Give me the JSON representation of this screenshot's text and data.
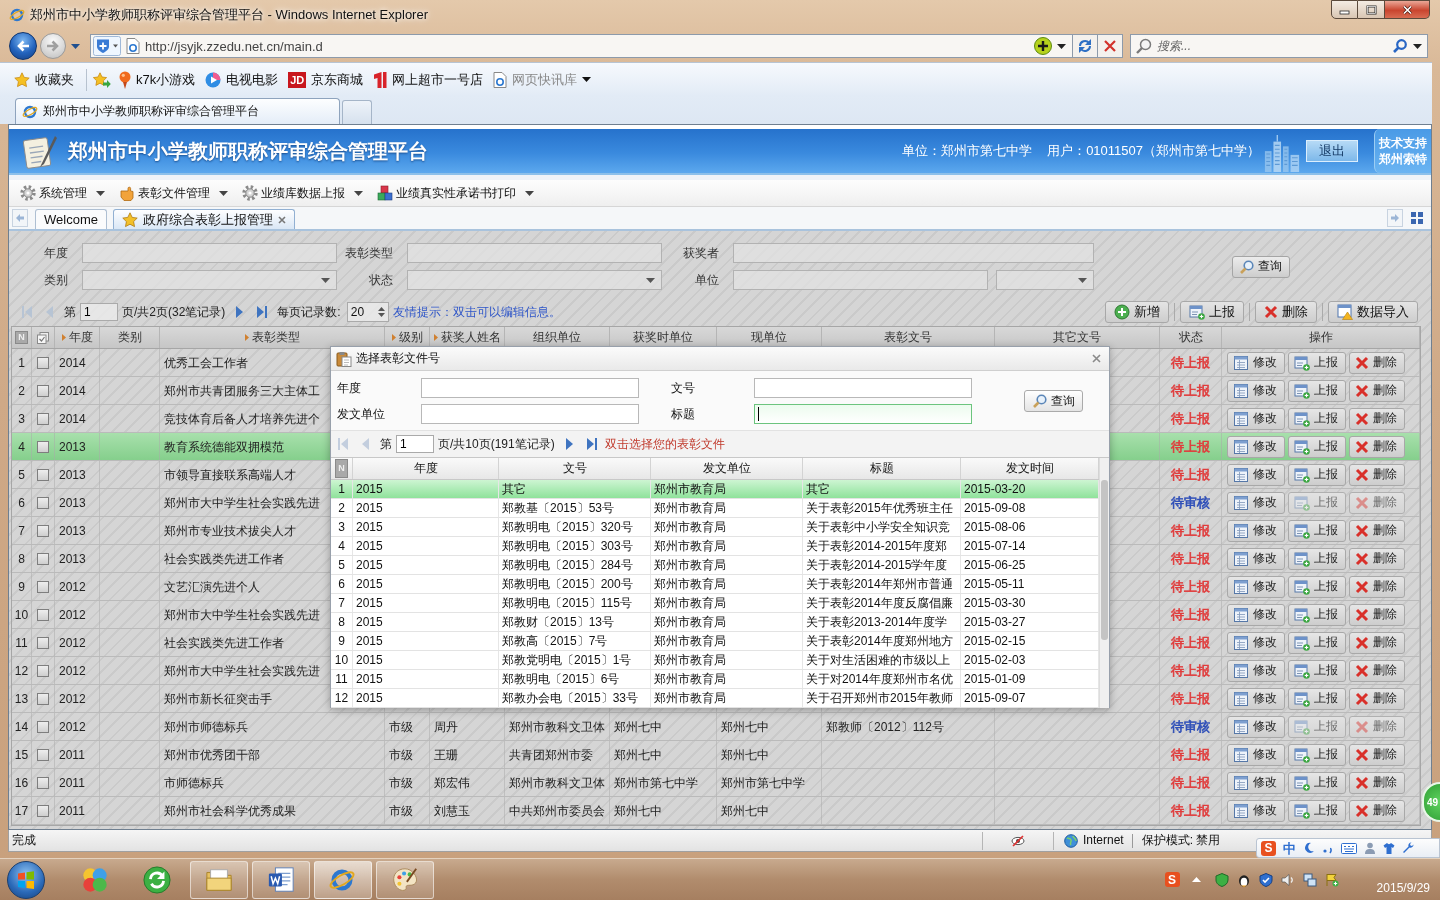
{
  "window": {
    "title": "郑州市中小学教师职称评审综合管理平台 - Windows Internet Explorer"
  },
  "address_bar": {
    "back_disabled": false,
    "forward_disabled": true,
    "url": "http://jsyjk.zzedu.net.cn/main.d"
  },
  "search_box": {
    "placeholder": "搜索..."
  },
  "favorites_bar": {
    "label": "收藏夹",
    "links": [
      {
        "kind": "pin",
        "label": "k7k小游戏",
        "disabled": false,
        "dropdown": false
      },
      {
        "kind": "play",
        "label": "电视电影",
        "disabled": false,
        "dropdown": false
      },
      {
        "kind": "badge",
        "badge": "JD",
        "label": "京东商城",
        "disabled": false,
        "dropdown": false
      },
      {
        "kind": "bars",
        "label": "网上超市一号店",
        "disabled": false,
        "dropdown": false
      },
      {
        "kind": "page",
        "label": "网页快讯库",
        "disabled": true,
        "dropdown": true
      }
    ]
  },
  "browser_tabs": [
    {
      "label": "郑州市中小学教师职称评审综合管理平台",
      "selected": true
    }
  ],
  "site_header": {
    "title": "郑州市中小学教师职称评审综合管理平台",
    "unit": "单位：郑州市第七中学",
    "user": "用户：01011507（郑州市第七中学）",
    "logout": "退出",
    "support": [
      "技术支持",
      "郑州索特"
    ]
  },
  "menu": [
    {
      "kind": "gear",
      "label": "系统管理"
    },
    {
      "kind": "hand",
      "label": "表彰文件管理"
    },
    {
      "kind": "gear",
      "label": "业绩库数据上报"
    },
    {
      "kind": "cubes",
      "label": "业绩真实性承诺书打印"
    }
  ],
  "page_tabs": [
    {
      "kind": "plain",
      "label": "Welcome",
      "selected": false,
      "closable": false
    },
    {
      "kind": "star",
      "label": "政府综合表彰上报管理",
      "selected": true,
      "closable": true
    }
  ],
  "filters": {
    "fields": [
      {
        "kind": "text",
        "label": "年度"
      },
      {
        "kind": "text",
        "label": "表彰类型"
      },
      {
        "kind": "text",
        "label": "获奖者"
      },
      {
        "kind": "select",
        "label": "类别"
      },
      {
        "kind": "select",
        "label": "状态"
      },
      {
        "kind": "text-select",
        "label": "单位"
      }
    ],
    "search_button": "查询"
  },
  "pager": {
    "nav": [
      {
        "kind": "first",
        "disabled": true
      },
      {
        "kind": "prev",
        "disabled": true
      },
      {
        "kind": "next",
        "disabled": false
      },
      {
        "kind": "last",
        "disabled": false
      }
    ],
    "page_label": "第",
    "page": "1",
    "page_info": "页/共2页(32笔记录)",
    "page_size_label": "每页记录数:",
    "page_size": "20",
    "hint": "友情提示：双击可以编辑信息。"
  },
  "toolbar": [
    {
      "kind": "add",
      "label": "新增"
    },
    {
      "kind": "report",
      "label": "上报"
    },
    {
      "kind": "delete",
      "label": "删除"
    },
    {
      "kind": "import",
      "label": "数据导入"
    }
  ],
  "table": {
    "number_header": "N",
    "columns": [
      {
        "label": "年度",
        "sortable": true
      },
      {
        "label": "类别",
        "sortable": false
      },
      {
        "label": "表彰类型",
        "sortable": true
      },
      {
        "label": "级别",
        "sortable": true
      },
      {
        "label": "获奖人姓名",
        "sortable": true
      },
      {
        "label": "组织单位",
        "sortable": false
      },
      {
        "label": "获奖时单位",
        "sortable": false
      },
      {
        "label": "现单位",
        "sortable": false
      },
      {
        "label": "表彰文号",
        "sortable": false
      },
      {
        "label": "其它文号",
        "sortable": false
      },
      {
        "label": "状态",
        "sortable": false
      },
      {
        "label": "操作",
        "sortable": false
      }
    ],
    "rows": [
      {
        "no": "1",
        "selected": false,
        "checked": false,
        "year": "2014",
        "award_type": "优秀工会工作者",
        "status": {
          "text": "待上报",
          "color": "#e03c3c"
        },
        "actions": [
          {
            "kind": "edit",
            "label": "修改",
            "disabled": false
          },
          {
            "kind": "report",
            "label": "上报",
            "disabled": false
          },
          {
            "kind": "delete",
            "label": "删除",
            "disabled": false
          }
        ]
      },
      {
        "no": "2",
        "selected": false,
        "checked": false,
        "year": "2014",
        "award_type": "郑州市共青团服务三大主体工",
        "status": {
          "text": "待上报",
          "color": "#e03c3c"
        },
        "actions": [
          {
            "kind": "edit",
            "label": "修改",
            "disabled": false
          },
          {
            "kind": "report",
            "label": "上报",
            "disabled": false
          },
          {
            "kind": "delete",
            "label": "删除",
            "disabled": false
          }
        ]
      },
      {
        "no": "3",
        "selected": false,
        "checked": false,
        "year": "2014",
        "award_type": "竞技体育后备人才培养先进个",
        "status": {
          "text": "待上报",
          "color": "#e03c3c"
        },
        "actions": [
          {
            "kind": "edit",
            "label": "修改",
            "disabled": false
          },
          {
            "kind": "report",
            "label": "上报",
            "disabled": false
          },
          {
            "kind": "delete",
            "label": "删除",
            "disabled": false
          }
        ]
      },
      {
        "no": "4",
        "selected": true,
        "checked": false,
        "year": "2013",
        "award_type": "教育系统德能双拥模范",
        "status": {
          "text": "待上报",
          "color": "#e03c3c"
        },
        "actions": [
          {
            "kind": "edit",
            "label": "修改",
            "disabled": false
          },
          {
            "kind": "report",
            "label": "上报",
            "disabled": false
          },
          {
            "kind": "delete",
            "label": "删除",
            "disabled": false
          }
        ]
      },
      {
        "no": "5",
        "selected": false,
        "checked": false,
        "year": "2013",
        "award_type": "市领导直接联系高端人才",
        "status": {
          "text": "待上报",
          "color": "#e03c3c"
        },
        "actions": [
          {
            "kind": "edit",
            "label": "修改",
            "disabled": false
          },
          {
            "kind": "report",
            "label": "上报",
            "disabled": false
          },
          {
            "kind": "delete",
            "label": "删除",
            "disabled": false
          }
        ]
      },
      {
        "no": "6",
        "selected": false,
        "checked": false,
        "year": "2013",
        "award_type": "郑州市大中学生社会实践先进",
        "status": {
          "text": "待审核",
          "color": "#2f4fb8"
        },
        "actions": [
          {
            "kind": "edit",
            "label": "修改",
            "disabled": false
          },
          {
            "kind": "report",
            "label": "上报",
            "disabled": true
          },
          {
            "kind": "delete",
            "label": "删除",
            "disabled": true
          }
        ]
      },
      {
        "no": "7",
        "selected": false,
        "checked": false,
        "year": "2013",
        "award_type": "郑州市专业技术拔尖人才",
        "status": {
          "text": "待上报",
          "color": "#e03c3c"
        },
        "actions": [
          {
            "kind": "edit",
            "label": "修改",
            "disabled": false
          },
          {
            "kind": "report",
            "label": "上报",
            "disabled": false
          },
          {
            "kind": "delete",
            "label": "删除",
            "disabled": false
          }
        ]
      },
      {
        "no": "8",
        "selected": false,
        "checked": false,
        "year": "2013",
        "award_type": "社会实践类先进工作者",
        "status": {
          "text": "待上报",
          "color": "#e03c3c"
        },
        "actions": [
          {
            "kind": "edit",
            "label": "修改",
            "disabled": false
          },
          {
            "kind": "report",
            "label": "上报",
            "disabled": false
          },
          {
            "kind": "delete",
            "label": "删除",
            "disabled": false
          }
        ]
      },
      {
        "no": "9",
        "selected": false,
        "checked": false,
        "year": "2012",
        "award_type": "文艺汇演先进个人",
        "status": {
          "text": "待上报",
          "color": "#e03c3c"
        },
        "actions": [
          {
            "kind": "edit",
            "label": "修改",
            "disabled": false
          },
          {
            "kind": "report",
            "label": "上报",
            "disabled": false
          },
          {
            "kind": "delete",
            "label": "删除",
            "disabled": false
          }
        ]
      },
      {
        "no": "10",
        "selected": false,
        "checked": false,
        "year": "2012",
        "award_type": "郑州市大中学生社会实践先进",
        "status": {
          "text": "待上报",
          "color": "#e03c3c"
        },
        "actions": [
          {
            "kind": "edit",
            "label": "修改",
            "disabled": false
          },
          {
            "kind": "report",
            "label": "上报",
            "disabled": false
          },
          {
            "kind": "delete",
            "label": "删除",
            "disabled": false
          }
        ]
      },
      {
        "no": "11",
        "selected": false,
        "checked": false,
        "year": "2012",
        "award_type": "社会实践类先进工作者",
        "status": {
          "text": "待上报",
          "color": "#e03c3c"
        },
        "actions": [
          {
            "kind": "edit",
            "label": "修改",
            "disabled": false
          },
          {
            "kind": "report",
            "label": "上报",
            "disabled": false
          },
          {
            "kind": "delete",
            "label": "删除",
            "disabled": false
          }
        ]
      },
      {
        "no": "12",
        "selected": false,
        "checked": false,
        "year": "2012",
        "award_type": "郑州市大中学生社会实践先进",
        "status": {
          "text": "待上报",
          "color": "#e03c3c"
        },
        "actions": [
          {
            "kind": "edit",
            "label": "修改",
            "disabled": false
          },
          {
            "kind": "report",
            "label": "上报",
            "disabled": false
          },
          {
            "kind": "delete",
            "label": "删除",
            "disabled": false
          }
        ]
      },
      {
        "no": "13",
        "selected": false,
        "checked": false,
        "year": "2012",
        "award_type": "郑州市新长征突击手",
        "status": {
          "text": "待上报",
          "color": "#e03c3c"
        },
        "actions": [
          {
            "kind": "edit",
            "label": "修改",
            "disabled": false
          },
          {
            "kind": "report",
            "label": "上报",
            "disabled": false
          },
          {
            "kind": "delete",
            "label": "删除",
            "disabled": false
          }
        ]
      },
      {
        "no": "14",
        "selected": false,
        "checked": false,
        "year": "2012",
        "award_type": "郑州市师德标兵",
        "level": "市级",
        "winner": "周丹",
        "org": "郑州市教科文卫体",
        "unit_at_award": "郑州七中",
        "unit_now": "郑州七中",
        "doc_no": "郑教师〔2012〕112号",
        "status": {
          "text": "待审核",
          "color": "#2f4fb8"
        },
        "actions": [
          {
            "kind": "edit",
            "label": "修改",
            "disabled": false
          },
          {
            "kind": "report",
            "label": "上报",
            "disabled": true
          },
          {
            "kind": "delete",
            "label": "删除",
            "disabled": true
          }
        ]
      },
      {
        "no": "15",
        "selected": false,
        "checked": false,
        "year": "2011",
        "award_type": "郑州市优秀团干部",
        "level": "市级",
        "winner": "王珊",
        "org": "共青团郑州市委",
        "unit_at_award": "郑州七中",
        "unit_now": "郑州七中",
        "status": {
          "text": "待上报",
          "color": "#e03c3c"
        },
        "actions": [
          {
            "kind": "edit",
            "label": "修改",
            "disabled": false
          },
          {
            "kind": "report",
            "label": "上报",
            "disabled": false
          },
          {
            "kind": "delete",
            "label": "删除",
            "disabled": false
          }
        ]
      },
      {
        "no": "16",
        "selected": false,
        "checked": false,
        "year": "2011",
        "award_type": "市师德标兵",
        "level": "市级",
        "winner": "郑宏伟",
        "org": "郑州市教科文卫体",
        "unit_at_award": "郑州市第七中学",
        "unit_now": "郑州市第七中学",
        "status": {
          "text": "待上报",
          "color": "#e03c3c"
        },
        "actions": [
          {
            "kind": "edit",
            "label": "修改",
            "disabled": false
          },
          {
            "kind": "report",
            "label": "上报",
            "disabled": false
          },
          {
            "kind": "delete",
            "label": "删除",
            "disabled": false
          }
        ]
      },
      {
        "no": "17",
        "selected": false,
        "checked": false,
        "year": "2011",
        "award_type": "郑州市社会科学优秀成果",
        "level": "市级",
        "winner": "刘慧玉",
        "org": "中共郑州市委员会",
        "unit_at_award": "郑州七中",
        "unit_now": "郑州七中",
        "status": {
          "text": "待上报",
          "color": "#e03c3c"
        },
        "actions": [
          {
            "kind": "edit",
            "label": "修改",
            "disabled": false
          },
          {
            "kind": "report",
            "label": "上报",
            "disabled": false
          },
          {
            "kind": "delete",
            "label": "删除",
            "disabled": false
          }
        ]
      }
    ]
  },
  "dialog": {
    "title": "选择表彰文件号",
    "fields": [
      {
        "label": "年度",
        "focused": false
      },
      {
        "label": "文号",
        "focused": false
      },
      {
        "label": "发文单位",
        "focused": false
      },
      {
        "label": "标题",
        "focused": true
      }
    ],
    "search_button": "查询",
    "pager": {
      "nav": [
        {
          "kind": "first",
          "disabled": true
        },
        {
          "kind": "prev",
          "disabled": true
        },
        {
          "kind": "next",
          "disabled": false
        },
        {
          "kind": "last",
          "disabled": false
        }
      ],
      "page_label": "第",
      "page": "1",
      "page_info": "页/共10页(191笔记录)",
      "hint": "双击选择您的表彰文件"
    },
    "number_header": "N",
    "columns": [
      "年度",
      "文号",
      "发文单位",
      "标题",
      "发文时间"
    ],
    "rows": [
      {
        "no": "1",
        "selected": true,
        "cells": [
          "2015",
          "其它",
          "郑州市教育局",
          "其它",
          "2015-03-20"
        ]
      },
      {
        "no": "2",
        "selected": false,
        "cells": [
          "2015",
          "郑教基〔2015〕53号",
          "郑州市教育局",
          "关于表彰2015年优秀班主任",
          "2015-09-08"
        ]
      },
      {
        "no": "3",
        "selected": false,
        "cells": [
          "2015",
          "郑教明电〔2015〕320号",
          "郑州市教育局",
          "关于表彰中小学安全知识竞",
          "2015-08-06"
        ]
      },
      {
        "no": "4",
        "selected": false,
        "cells": [
          "2015",
          "郑教明电〔2015〕303号",
          "郑州市教育局",
          "关于表彰2014-2015年度郑",
          "2015-07-14"
        ]
      },
      {
        "no": "5",
        "selected": false,
        "cells": [
          "2015",
          "郑教明电〔2015〕284号",
          "郑州市教育局",
          "关于表彰2014-2015学年度",
          "2015-06-25"
        ]
      },
      {
        "no": "6",
        "selected": false,
        "cells": [
          "2015",
          "郑教明电〔2015〕200号",
          "郑州市教育局",
          "关于表彰2014年郑州市普通",
          "2015-05-11"
        ]
      },
      {
        "no": "7",
        "selected": false,
        "cells": [
          "2015",
          "郑教明电〔2015〕115号",
          "郑州市教育局",
          "关于表彰2014年度反腐倡廉",
          "2015-03-30"
        ]
      },
      {
        "no": "8",
        "selected": false,
        "cells": [
          "2015",
          "郑教财〔2015〕13号",
          "郑州市教育局",
          "关于表彰2013-2014年度学",
          "2015-03-27"
        ]
      },
      {
        "no": "9",
        "selected": false,
        "cells": [
          "2015",
          "郑教高〔2015〕7号",
          "郑州市教育局",
          "关于表彰2014年度郑州地方",
          "2015-02-15"
        ]
      },
      {
        "no": "10",
        "selected": false,
        "cells": [
          "2015",
          "郑教党明电〔2015〕1号",
          "郑州市教育局",
          "关于对生活困难的市级以上",
          "2015-02-03"
        ]
      },
      {
        "no": "11",
        "selected": false,
        "cells": [
          "2015",
          "郑教明电〔2015〕6号",
          "郑州市教育局",
          "关于对2014年度郑州市名优",
          "2015-01-09"
        ]
      },
      {
        "no": "12",
        "selected": false,
        "cells": [
          "2015",
          "郑教办会电〔2015〕33号",
          "郑州市教育局",
          "关于召开郑州市2015年教师",
          "2015-09-07"
        ]
      }
    ]
  },
  "status_bar": {
    "text": "完成",
    "zone": "Internet",
    "mode": "保护模式: 禁用"
  },
  "ime_toolbar": {
    "logo": "S",
    "mode": "中"
  },
  "floating_ball": {
    "text": "49"
  },
  "taskbar": {
    "items": [
      {
        "kind": "balls",
        "running": false,
        "active": false
      },
      {
        "kind": "refresh",
        "running": false,
        "active": false
      },
      {
        "kind": "folder",
        "running": true,
        "active": false
      },
      {
        "kind": "document",
        "running": true,
        "active": false
      },
      {
        "kind": "browser",
        "running": true,
        "active": true
      },
      {
        "kind": "palette",
        "running": true,
        "active": false
      }
    ],
    "tray": {
      "logo": "S",
      "date": "2015/9/29"
    }
  }
}
